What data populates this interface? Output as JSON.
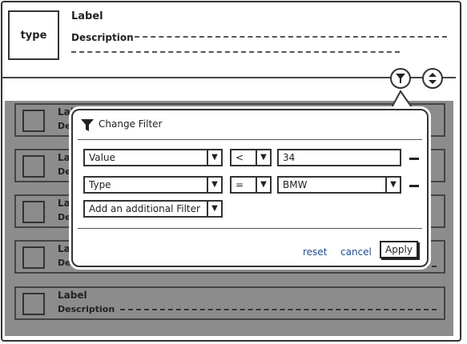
{
  "header": {
    "thumb_text": "type",
    "label": "Label",
    "description": "Description"
  },
  "list_items": [
    {
      "label": "Lab",
      "description": "Des"
    },
    {
      "label": "Lab",
      "description": "Des"
    },
    {
      "label": "Lab",
      "description": "Des"
    },
    {
      "label": "Lab",
      "description": "Description"
    },
    {
      "label": "Label",
      "description": "Description"
    }
  ],
  "popup": {
    "title": "Change Filter",
    "rows": [
      {
        "field": "Value",
        "operator": "<",
        "value": "34",
        "value_type": "text"
      },
      {
        "field": "Type",
        "operator": "=",
        "value": "BMW",
        "value_type": "dropdown"
      }
    ],
    "add_filter": "Add an additional Filter",
    "reset": "reset",
    "cancel": "cancel",
    "apply": "Apply"
  },
  "icons": {
    "filter": "filter-icon",
    "sort": "sort-icon",
    "dropdown": "chevron-down-icon",
    "remove": "minus-icon"
  },
  "colors": {
    "overlay": "#8c8c8c",
    "link": "#1f4e8a"
  }
}
